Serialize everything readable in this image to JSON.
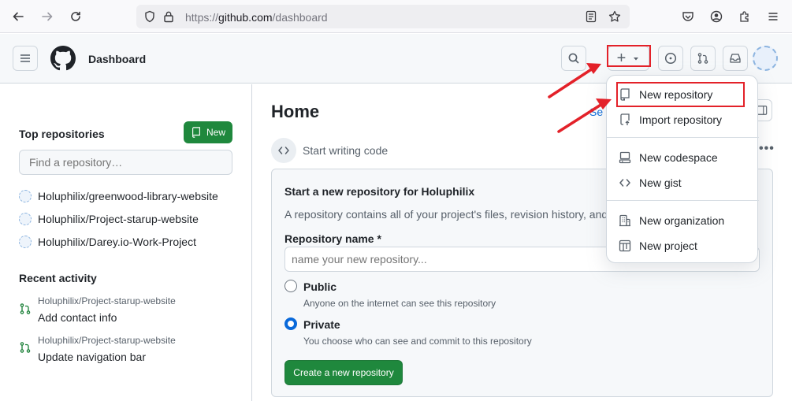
{
  "browser": {
    "url_prefix": "https://",
    "url_host": "github.com",
    "url_path": "/dashboard"
  },
  "header": {
    "title": "Dashboard",
    "create_symbol": "+"
  },
  "sidebar": {
    "top_repositories_title": "Top repositories",
    "new_button_label": "New",
    "find_placeholder": "Find a repository…",
    "repositories": [
      "Holuphilix/greenwood-library-website",
      "Holuphilix/Project-starup-website",
      "Holuphilix/Darey.io-Work-Project"
    ],
    "recent_activity_title": "Recent activity",
    "activity": [
      {
        "repo": "Holuphilix/Project-starup-website",
        "message": "Add contact info"
      },
      {
        "repo": "Holuphilix/Project-starup-website",
        "message": "Update navigation bar"
      }
    ]
  },
  "main": {
    "title": "Home",
    "start_writing": "Start writing code",
    "partial_link": "Se",
    "card": {
      "title": "Start a new repository for Holuphilix",
      "description": "A repository contains all of your project's files, revision history, and",
      "name_label": "Repository name *",
      "name_placeholder": "name your new repository...",
      "public_label": "Public",
      "public_desc": "Anyone on the internet can see this repository",
      "private_label": "Private",
      "private_desc": "You choose who can see and commit to this repository",
      "visibility_selected": "Private",
      "create_button": "Create a new repository"
    }
  },
  "dropdown": {
    "items": [
      {
        "label": "New repository",
        "icon": "repo-icon"
      },
      {
        "label": "Import repository",
        "icon": "repo-push-icon"
      },
      {
        "label": "New codespace",
        "icon": "codespaces-icon"
      },
      {
        "label": "New gist",
        "icon": "code-icon"
      },
      {
        "label": "New organization",
        "icon": "organization-icon"
      },
      {
        "label": "New project",
        "icon": "table-icon"
      }
    ]
  },
  "colors": {
    "primary_button": "#1f883d",
    "annotation_red": "#e32129",
    "link_blue": "#0969da"
  }
}
